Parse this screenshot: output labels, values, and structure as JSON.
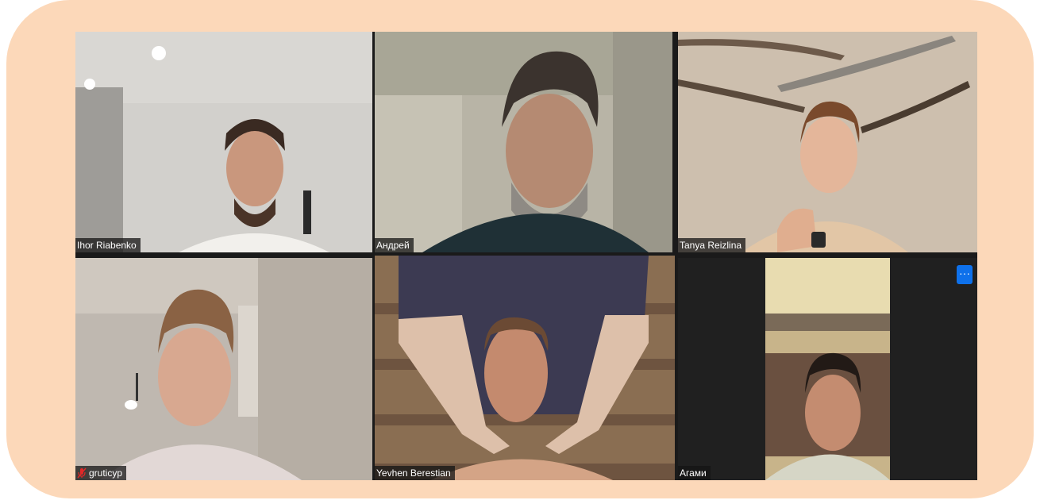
{
  "participants": [
    {
      "name": "Ihor Riabenko",
      "muted": false,
      "active": false
    },
    {
      "name": "Андрей",
      "muted": false,
      "active": false
    },
    {
      "name": "Tanya Reizlina",
      "muted": false,
      "active": false
    },
    {
      "name": "gruticyp",
      "muted": true,
      "active": false
    },
    {
      "name": "Yevhen Berestian",
      "muted": false,
      "active": true
    },
    {
      "name": "Агами",
      "muted": false,
      "active": false
    }
  ],
  "more_button": {
    "label": "···"
  },
  "colors": {
    "frame": "#fcd8b9",
    "active_speaker_border": "#b8d65a",
    "more_button": "#0e71eb",
    "muted_mic": "#e02828"
  }
}
